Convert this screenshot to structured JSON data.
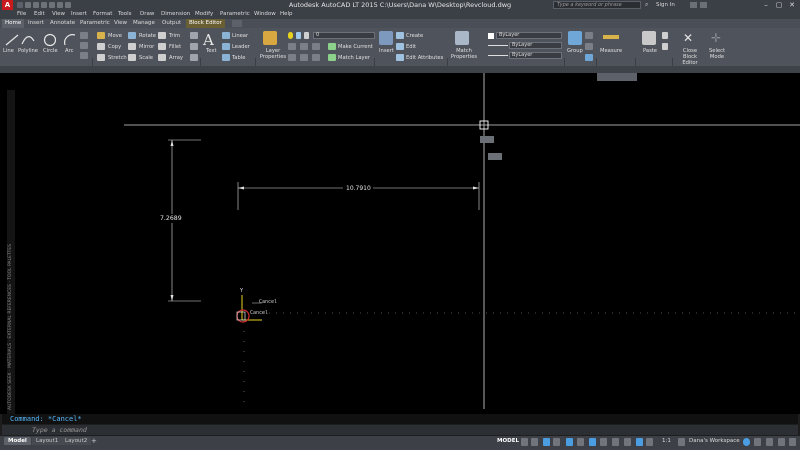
{
  "window": {
    "title": "Autodesk AutoCAD LT 2015    C:\\Users\\Dana W\\Desktop\\Revcloud.dwg",
    "search_placeholder": "Type a keyword or phrase",
    "sign_in": "Sign In"
  },
  "menus": [
    "File",
    "Edit",
    "View",
    "Insert",
    "Format",
    "Tools",
    "Draw",
    "Dimension",
    "Modify",
    "Parametric",
    "Window",
    "Help"
  ],
  "tabs": [
    "Home",
    "Insert",
    "Annotate",
    "Parametric",
    "View",
    "Manage",
    "Output",
    "Block Editor"
  ],
  "ribbon": {
    "draw": [
      "Line",
      "Polyline",
      "Circle",
      "Arc"
    ],
    "modify": [
      "Move",
      "Rotate",
      "Trim",
      "Copy",
      "Mirror",
      "Fillet",
      "Stretch",
      "Scale",
      "Array"
    ],
    "annotation": [
      "Text",
      "Linear",
      "Leader",
      "Table"
    ],
    "layers": {
      "layer_properties": "Layer Properties",
      "current_layer": "0",
      "make_current": "Make Current",
      "match_layer": "Match Layer"
    },
    "block": {
      "insert": "Insert",
      "create": "Create",
      "edit": "Edit",
      "edit_attributes": "Edit Attributes"
    },
    "properties": {
      "match_properties": "Match Properties",
      "color": "ByLayer",
      "linetype": "ByLayer",
      "lineweight": "ByLayer"
    },
    "groups": {
      "group": "Group"
    },
    "utilities": {
      "measure": "Measure"
    },
    "clipboard": {
      "paste": "Paste"
    },
    "close": {
      "close_block_editor": "Close Block Editor",
      "select_mode": "Select Mode"
    }
  },
  "drawing": {
    "dim_horizontal": "10.7910",
    "dim_vertical": "7.2689",
    "ucs_y": "Y",
    "cursor_tooltip1": "Cancel",
    "tooltip_text1": "Cancel",
    "tooltip_text2": "Cancel"
  },
  "palette_label": "AUTODESK SEEK · MATERIALS · EXTERNAL REFERENCES · TOOL PALETTES",
  "command": {
    "history": "Command: *Cancel*",
    "placeholder": "Type a command"
  },
  "layout_tabs": [
    "Model",
    "Layout1",
    "Layout2"
  ],
  "status": {
    "model": "MODEL",
    "scale": "1:1",
    "workspace": "Dana's Workspace"
  },
  "colors": {
    "accent_red": "#c8191d",
    "crosshair": "#ffffff",
    "ucs_yellow": "#e8d21d",
    "cmd_blue": "#55b9ff"
  }
}
